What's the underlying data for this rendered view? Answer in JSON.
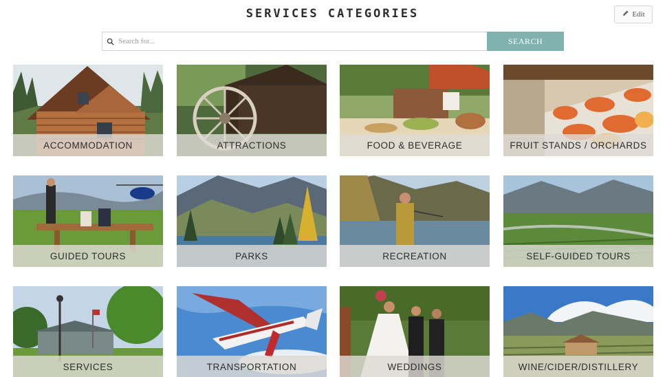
{
  "header": {
    "title": "SERVICES CATEGORIES",
    "edit_label": "Edit"
  },
  "search": {
    "placeholder": "Search for...",
    "value": "",
    "button_label": "SEARCH",
    "button_color": "#7fb2ac"
  },
  "categories": [
    {
      "label": "ACCOMMODATION",
      "icon": "log-cabin-photo"
    },
    {
      "label": "ATTRACTIONS",
      "icon": "water-wheel-mill-photo"
    },
    {
      "label": "FOOD & BEVERAGE",
      "icon": "outdoor-buffet-photo"
    },
    {
      "label": "FRUIT STANDS / ORCHARDS",
      "icon": "fruit-stand-photo"
    },
    {
      "label": "GUIDED TOURS",
      "icon": "picnic-helicopter-photo"
    },
    {
      "label": "PARKS",
      "icon": "mountain-lake-photo"
    },
    {
      "label": "RECREATION",
      "icon": "fly-fishing-photo"
    },
    {
      "label": "SELF-GUIDED TOURS",
      "icon": "valley-vineyard-photo"
    },
    {
      "label": "SERVICES",
      "icon": "heritage-building-photo"
    },
    {
      "label": "TRANSPORTATION",
      "icon": "small-airplane-photo"
    },
    {
      "label": "WEDDINGS",
      "icon": "outdoor-wedding-photo"
    },
    {
      "label": "WINE/CIDER/DISTILLERY",
      "icon": "winery-valley-photo"
    }
  ]
}
